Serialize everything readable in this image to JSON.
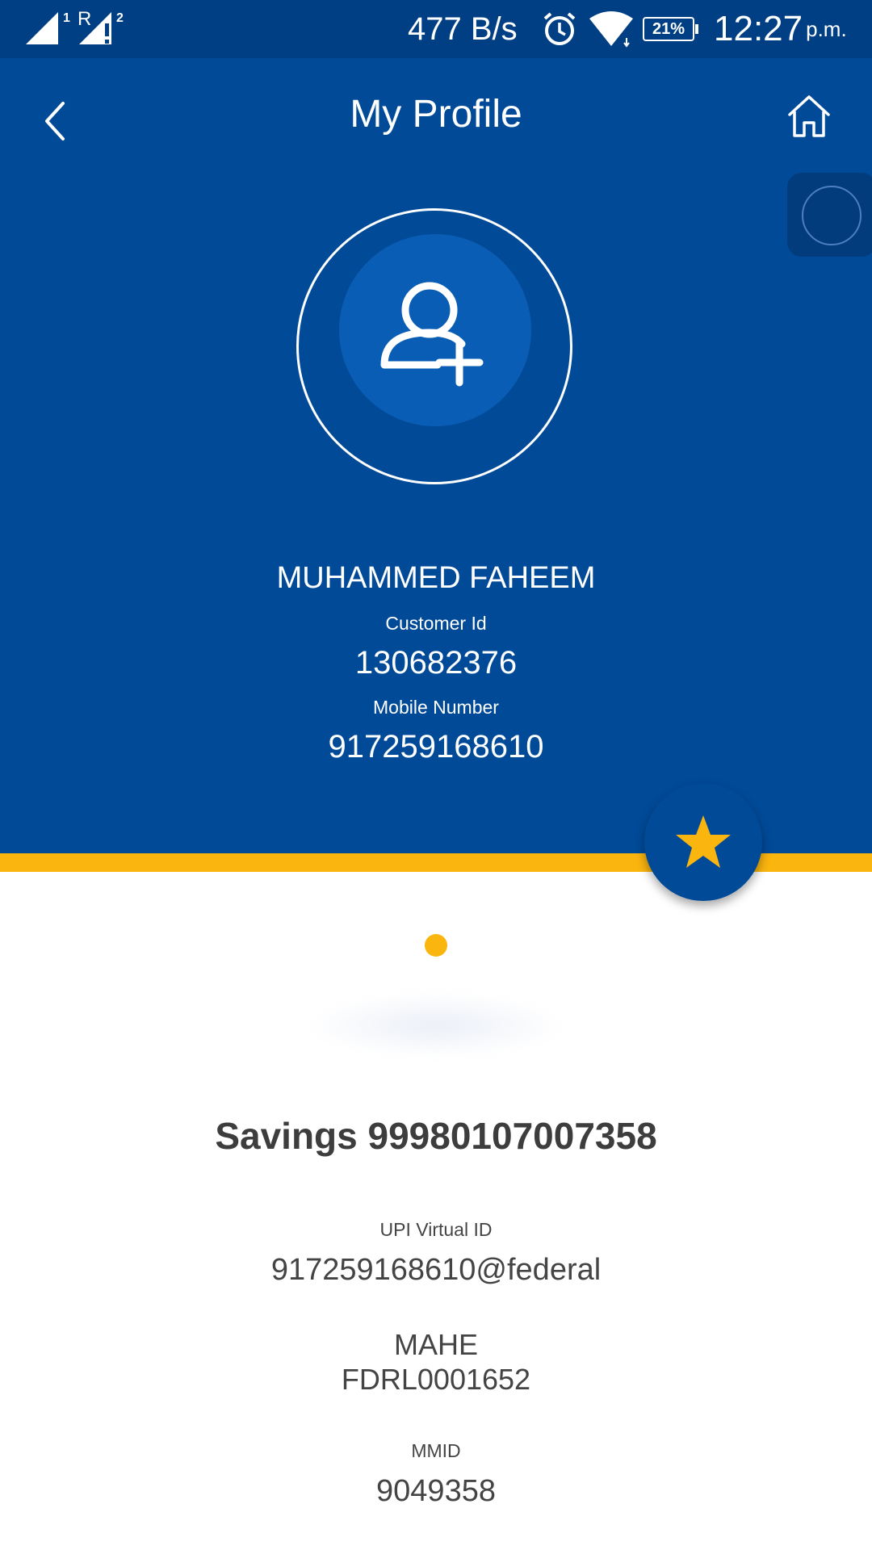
{
  "status_bar": {
    "sim1": "1",
    "sim2_roaming": "R",
    "sim2": "2",
    "speed": "477 B/s",
    "battery": "21%",
    "time": "12:27",
    "ampm": "p.m."
  },
  "header": {
    "title": "My Profile"
  },
  "profile": {
    "name": "MUHAMMED FAHEEM",
    "customer_id_label": "Customer Id",
    "customer_id": "130682376",
    "mobile_label": "Mobile Number",
    "mobile": "917259168610"
  },
  "account": {
    "title": "Savings 99980107007358",
    "upi_label": "UPI Virtual ID",
    "upi_id": "917259168610@federal",
    "branch": "MAHE",
    "ifsc": "FDRL0001652",
    "mmid_label": "MMID",
    "mmid": "9049358"
  },
  "colors": {
    "primary": "#004a98",
    "status_bar": "#003f84",
    "accent": "#fbb50f"
  }
}
